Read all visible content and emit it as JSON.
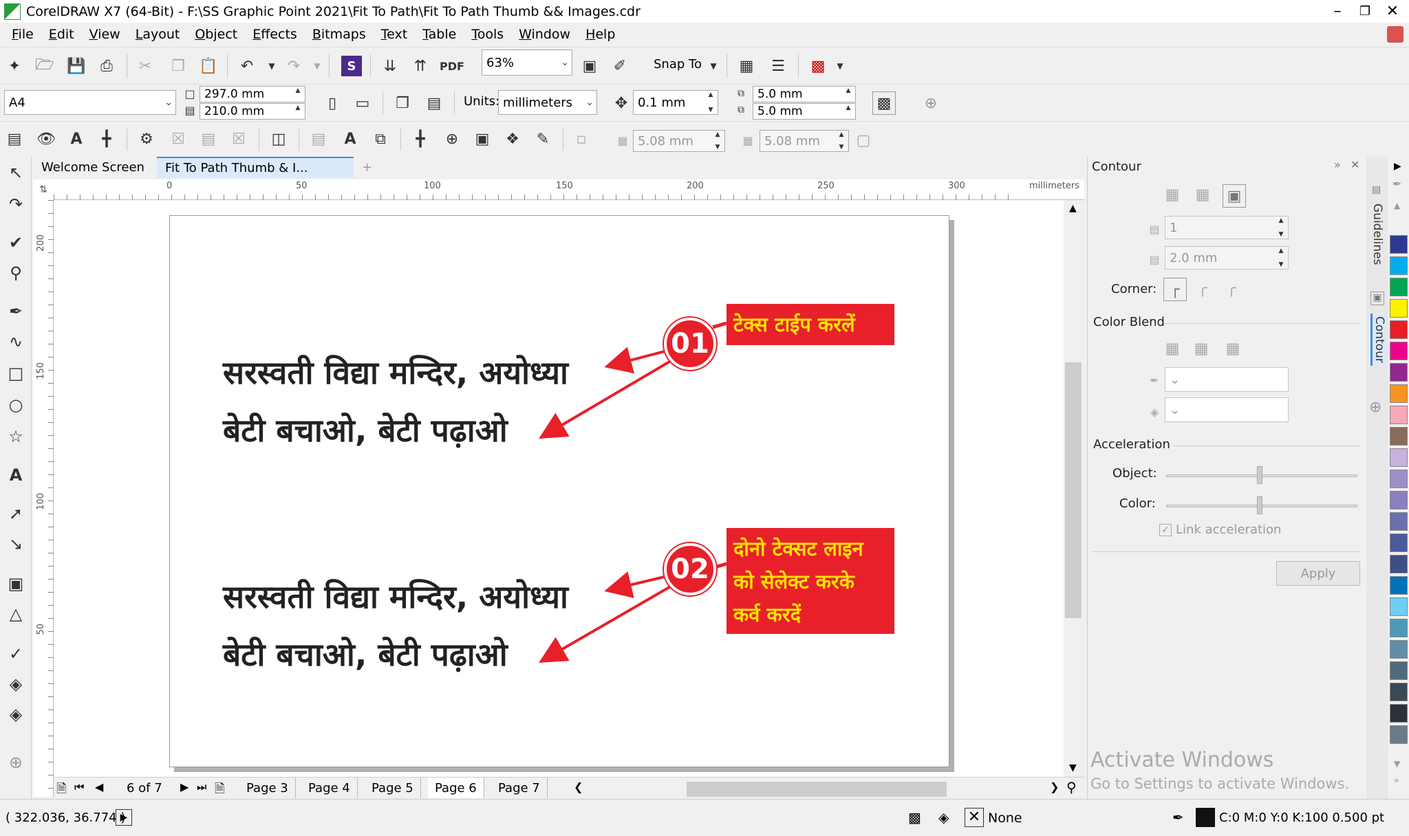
{
  "window": {
    "title": "CorelDRAW X7 (64-Bit) - F:\\SS Graphic Point 2021\\Fit To Path\\Fit To Path Thumb && Images.cdr"
  },
  "menu": [
    "File",
    "Edit",
    "View",
    "Layout",
    "Object",
    "Effects",
    "Bitmaps",
    "Text",
    "Table",
    "Tools",
    "Window",
    "Help"
  ],
  "toolbar": {
    "zoom": "63%",
    "snap_to": "Snap To"
  },
  "property_bar": {
    "page_size": "A4",
    "width": "297.0 mm",
    "height": "210.0 mm",
    "units_label": "Units:",
    "units": "millimeters",
    "nudge": "0.1 mm",
    "dup_x": "5.0 mm",
    "dup_y": "5.0 mm",
    "grid_x": "5.08 mm",
    "grid_y": "5.08 mm"
  },
  "tabs": [
    "Welcome Screen",
    "Fit To Path Thumb & I..."
  ],
  "ruler": {
    "h_ticks": [
      "0",
      "50",
      "100",
      "150",
      "200",
      "250",
      "300"
    ],
    "v_ticks": [
      "200",
      "150",
      "100",
      "50"
    ],
    "unit": "millimeters"
  },
  "document": {
    "line1": "सरस्वती विद्या मन्दिर, अयोध्या",
    "line2": "बेटी बचाओ, बेटी पढ़ाओ",
    "line3": "सरस्वती विद्या मन्दिर, अयोध्या",
    "line4": "बेटी बचाओ, बेटी पढ़ाओ",
    "step1_number": "01",
    "step1_text": "टेक्स टाईप करलें",
    "step2_number": "02",
    "step2_text_l1": "दोनो टेक्सट लाइन",
    "step2_text_l2": "को सेलेक्ट करके",
    "step2_text_l3": "कर्व करदें"
  },
  "pages": {
    "counter": "6 of 7",
    "tabs": [
      "Page 3",
      "Page 4",
      "Page 5",
      "Page 6",
      "Page 7"
    ],
    "active": "Page 6"
  },
  "status": {
    "coords": "( 322.036, 36.774 )",
    "fill": "None",
    "outline": "C:0 M:0 Y:0 K:100  0.500 pt"
  },
  "docker": {
    "title": "Contour",
    "steps": "1",
    "offset": "2.0 mm",
    "corner_label": "Corner:",
    "color_blend_label": "Color Blend",
    "acceleration_label": "Acceleration",
    "object_label": "Object:",
    "color_label": "Color:",
    "link_label": "Link acceleration",
    "apply_label": "Apply"
  },
  "side_tabs": [
    "Guidelines",
    "Contour"
  ],
  "watermark": {
    "line1": "Activate Windows",
    "line2": "Go to Settings to activate Windows."
  },
  "palette": [
    "#2b3990",
    "#00aeef",
    "#00a651",
    "#fff200",
    "#ed1c24",
    "#ec008c",
    "#92278f",
    "#f7941d",
    "#f9a8b8",
    "#8b6b5a",
    "#c7b2de",
    "#9e8fc7",
    "#8c7fbd",
    "#6a6fb0",
    "#4a5a9a",
    "#3f4f86",
    "#0072bc",
    "#6dcff6",
    "#4a9ab8",
    "#5f8ea8",
    "#506a7a",
    "#3a4a55",
    "#2a333a",
    "#6b7a8a"
  ]
}
